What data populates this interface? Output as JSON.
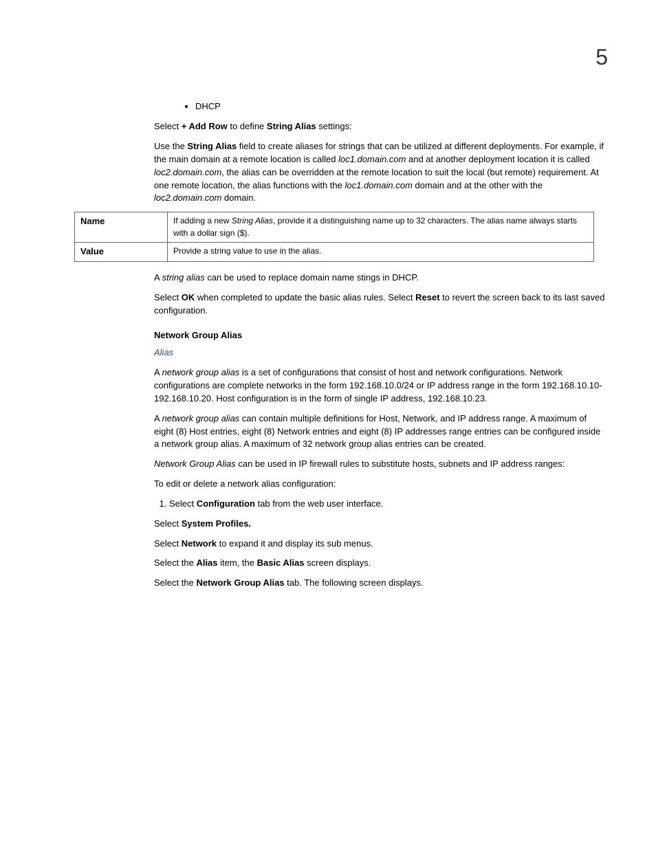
{
  "page_number": "5",
  "bullets": [
    "DHCP"
  ],
  "p1": {
    "pre": "Select ",
    "b1": "+ Add Row",
    "mid": " to define ",
    "b2": "String Alias",
    "post": " settings:"
  },
  "p2": {
    "pre": "Use the ",
    "b1": "String Alias",
    "t1": " field to create aliases for strings that can be utilized at different deployments. For example, if the main domain at a remote location is called ",
    "i1": "loc1.domain.com",
    "t2": " and at another deployment location it is called ",
    "i2": "loc2.domain.com",
    "t3": ", the alias can be overridden at the remote location to suit the local (but remote) requirement. At one remote location, the alias functions with the ",
    "i3": "loc1.domain.com",
    "t4": " domain and at the other with the ",
    "i4": "loc2.domain.com",
    "t5": " domain."
  },
  "table": {
    "r1": {
      "term": "Name",
      "d_pre": "If adding a new ",
      "d_i": "String Alias",
      "d_post": ", provide it a distinguishing name up to 32 characters. The alias name always starts with a dollar sign ($)."
    },
    "r2": {
      "term": "Value",
      "desc": "Provide a string value to use in the alias."
    }
  },
  "p3": {
    "pre": "A ",
    "i1": "string alias",
    "post": " can be used to replace domain name stings in DHCP."
  },
  "p4": {
    "pre": "Select ",
    "b1": "OK",
    "mid": " when completed to update the basic alias rules. Select ",
    "b2": "Reset",
    "post": " to revert the screen back to its last saved configuration."
  },
  "hdr_nga": "Network Group Alias",
  "link_alias": "Alias",
  "p5": {
    "pre": "A ",
    "i1": "network group alias",
    "post": " is a set of configurations that consist of host and network configurations. Network configurations are complete networks in the form 192.168.10.0/24 or IP address range in the form 192.168.10.10-192.168.10.20. Host configuration is in the form of single IP address, 192.168.10.23."
  },
  "p6": {
    "pre": "A ",
    "i1": "network group alias",
    "post": " can contain multiple definitions for Host, Network, and IP address range. A maximum of eight (8) Host entries, eight (8) Network entries and eight (8) IP addresses range entries can be configured inside a network group alias. A maximum of 32 network group alias entries can be created."
  },
  "p7": {
    "i1": "Network Group Alias",
    "post": " can be used in IP firewall rules to substitute hosts, subnets and IP address ranges:"
  },
  "p8": "To edit or delete a network alias configuration:",
  "ol1": {
    "pre": "Select ",
    "b1": "Configuration",
    "post": " tab from the web user interface."
  },
  "p9": {
    "pre": "Select ",
    "b1": "System Profiles."
  },
  "p10": {
    "pre": "Select ",
    "b1": "Network",
    "post": " to expand it and display its sub menus."
  },
  "p11": {
    "pre": "Select the ",
    "b1": "Alias",
    "mid": " item, the ",
    "b2": "Basic Alias",
    "post": " screen displays."
  },
  "p12": {
    "pre": "Select the ",
    "b1": "Network Group Alias",
    "post": " tab. The following screen displays."
  }
}
